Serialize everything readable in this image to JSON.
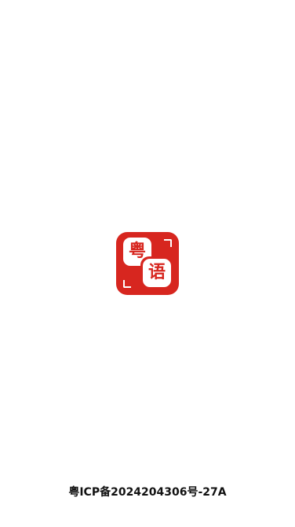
{
  "logo": {
    "top_char": "粤",
    "bottom_char": "语",
    "color": "#d7261f"
  },
  "footer": {
    "icp_text": "粤ICP备2024204306号-27A"
  }
}
